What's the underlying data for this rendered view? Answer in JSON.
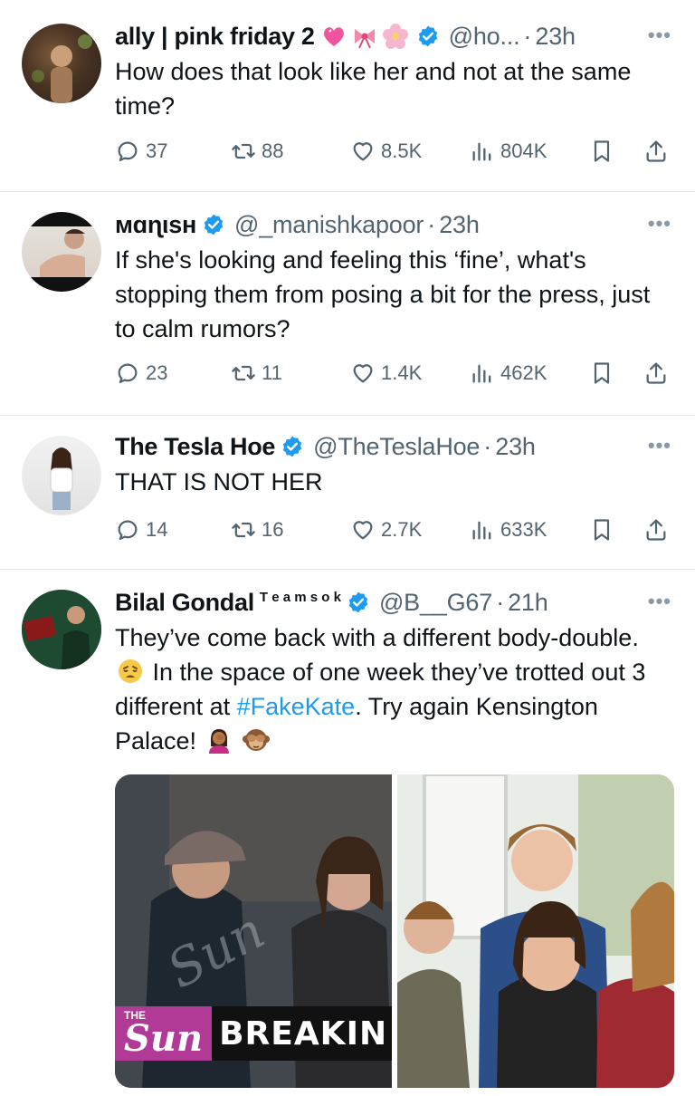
{
  "tweets": [
    {
      "name": "ally | pink friday 2",
      "name_emojis": [
        "heart-icon",
        "bow-icon",
        "flower-icon"
      ],
      "handle": "@ho...",
      "time": "23h",
      "text": "How does that look like her and not at the same time?",
      "replies": "37",
      "retweets": "88",
      "likes": "8.5K",
      "views": "804K"
    },
    {
      "name": "ᴍɑɳιsʜ",
      "handle": "@_manishkapoor",
      "time": "23h",
      "text": "If she's looking and feeling this ‘fine’, what's stopping them from posing a bit for the press, just to calm rumors?",
      "replies": "23",
      "retweets": "11",
      "likes": "1.4K",
      "views": "462K"
    },
    {
      "name": "The Tesla Hoe",
      "handle": "@TheTeslaHoe",
      "time": "23h",
      "text": "THAT IS NOT HER",
      "replies": "14",
      "retweets": "16",
      "likes": "2.7K",
      "views": "633K"
    },
    {
      "name": "Bilal Gondal",
      "name_suffix": "T e a m s o k",
      "handle": "@B__G67",
      "time": "21h",
      "text_part1": "They’ve come back with a different body-double.",
      "text_part2": " In the space of one week they’ve trotted out 3 different at ",
      "hashtag": "#FakeKate",
      "text_part3": ". Try again Kensington Palace!",
      "media_left_logo": "Sun",
      "media_left_logo_top": "THE",
      "media_left_banner": "BREAKIN"
    }
  ],
  "more_label": "•••",
  "dot": "·",
  "colors": {
    "accent": "#1d9bf0",
    "muted": "#536471",
    "verified": "#1d9bf0"
  }
}
